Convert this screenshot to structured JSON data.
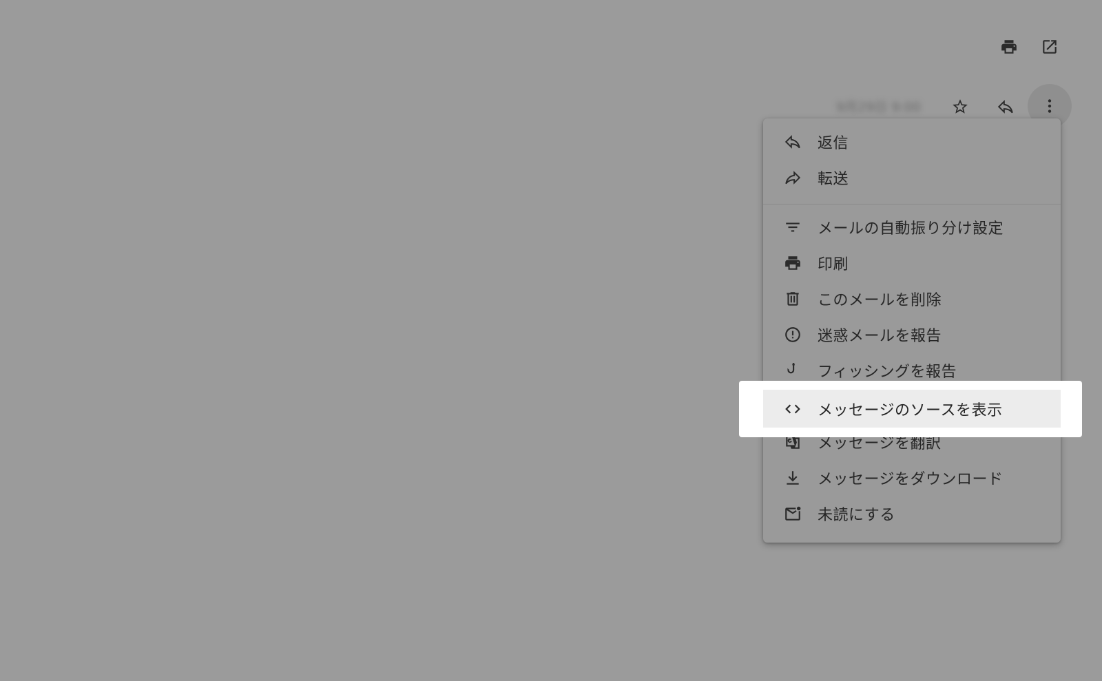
{
  "toolbar": {
    "top_icons": [
      "print-icon",
      "open-in-new-window-icon"
    ],
    "date_blurred": "9月29日 9:00"
  },
  "actions": {
    "icons": [
      "star-icon",
      "reply-icon",
      "more-vertical-icon"
    ]
  },
  "menu": {
    "items": [
      {
        "label": "返信",
        "icon": "reply-icon"
      },
      {
        "label": "転送",
        "icon": "forward-icon"
      },
      {
        "label": "メールの自動振り分け設定",
        "icon": "filter-icon"
      },
      {
        "label": "印刷",
        "icon": "print-icon"
      },
      {
        "label": "このメールを削除",
        "icon": "trash-icon"
      },
      {
        "label": "迷惑メールを報告",
        "icon": "spam-icon"
      },
      {
        "label": "フィッシングを報告",
        "icon": "phishing-hook-icon"
      },
      {
        "label": "メッセージのソースを表示",
        "icon": "code-icon"
      },
      {
        "label": "メッセージを翻訳",
        "icon": "translate-icon"
      },
      {
        "label": "メッセージをダウンロード",
        "icon": "download-icon"
      },
      {
        "label": "未読にする",
        "icon": "mark-unread-icon"
      }
    ],
    "highlighted_index": 7
  }
}
